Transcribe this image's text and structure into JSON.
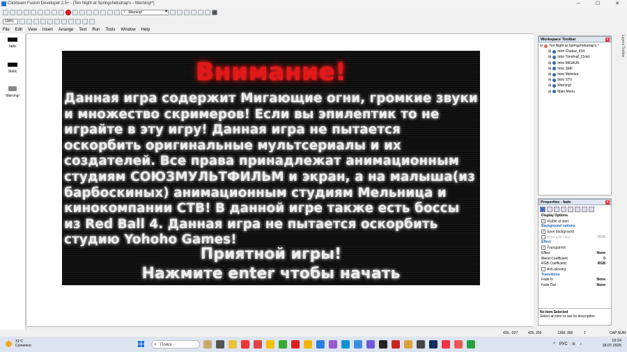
{
  "window": {
    "title": "Clickteam Fusion Developer 2.5+ - [Ten Night at Springchebutrap's - Warning!*]"
  },
  "toolbar": {
    "frame_select": "7 - Warning!",
    "zoom": "100%"
  },
  "menu": [
    "File",
    "Edit",
    "View",
    "Insert",
    "Arrange",
    "Text",
    "Run",
    "Tools",
    "Window",
    "Help"
  ],
  "left_panel": {
    "items": [
      {
        "label": "fade",
        "icon": "black-rectangle-icon"
      },
      {
        "label": "Static",
        "icon": "black-rectangle-icon"
      },
      {
        "label": "Warning!",
        "icon": "text-object-icon"
      }
    ]
  },
  "stage": {
    "heading": "Внимание!",
    "body": "Данная игра содержит Мигающие огни, громкие звуки и множество скримеров! Если вы эпилептик то не играйте в эту игру! Данная игра не пытается оскорбить оригинальные мультсериалы и их создателей. Все права принадлежат анимационным студиям СОЮЗМУЛЬТФИЛЬМ и экран, а на малыша(из барбоскиных) анимационным студиям Мельница и кинокомпании СТВ! В данной игре также есть боссы из Red Ball 4. Данная игра не пытается оскорбить студию Yohoho Games!",
    "footer_line1": "Приятной игры!",
    "footer_line2": "Нажмите enter чтобы начать"
  },
  "workspace": {
    "title": "Workspace Toolbar",
    "root": "Ten Night at Springchebutrap's *",
    "frames": [
      "Intro Chebur_434",
      "Intro Timofnaf_21md",
      "Intro MIGAUN",
      "Intro SMF",
      "Intro Melnitza",
      "Intro STV",
      "Warning!",
      "Main Menu"
    ]
  },
  "properties": {
    "title": "Properties - fade",
    "rows": [
      {
        "kind": "section",
        "label": "Display Options"
      },
      {
        "kind": "check",
        "label": "Visible at start",
        "checked": true
      },
      {
        "kind": "sub",
        "label": "Background options"
      },
      {
        "kind": "check",
        "label": "Save background",
        "checked": true
      },
      {
        "kind": "check-muted",
        "label": "Wipe with color",
        "checked": false,
        "value": "RGB"
      },
      {
        "kind": "sub",
        "label": "Effect"
      },
      {
        "kind": "check",
        "label": "Transparent",
        "checked": true
      },
      {
        "kind": "value",
        "label": "Effect",
        "value": "None"
      },
      {
        "kind": "value",
        "label": "Blend Coefficient",
        "value": "0"
      },
      {
        "kind": "value",
        "label": "RGB Coefficient",
        "value": "RGB"
      },
      {
        "kind": "check",
        "label": "Anti-aliasing",
        "checked": false
      },
      {
        "kind": "sub",
        "label": "Transitions"
      },
      {
        "kind": "value",
        "label": "Fade In",
        "value": "None"
      },
      {
        "kind": "value",
        "label": "Fade Out",
        "value": "None"
      }
    ],
    "desc_title": "No Item Selected",
    "desc_text": "Select an item to see its description"
  },
  "layers_tab": "Layers Toolbar",
  "status": {
    "coords": "435, -327",
    "size": "425, 250",
    "frame_size": "1358, 396",
    "count": "1",
    "mode": "CAP NUM"
  },
  "taskbar": {
    "weather_temp": "31°C",
    "weather_text": "Солнечно",
    "search": "Поиск",
    "lang": "РУС",
    "time": "16:24",
    "date": "18.07.2025"
  }
}
